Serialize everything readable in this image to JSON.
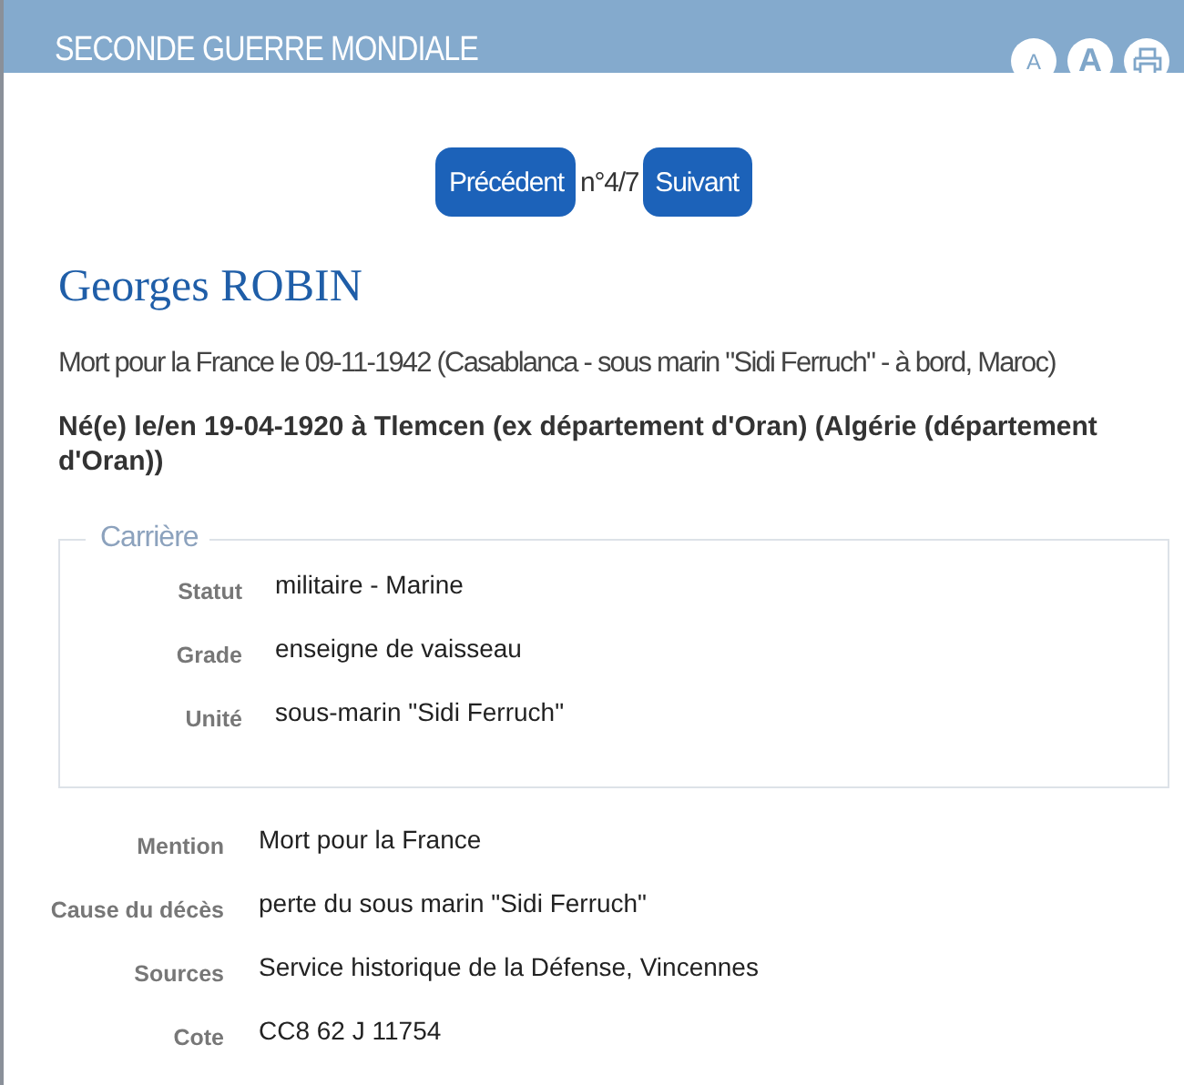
{
  "header": {
    "title": "SECONDE GUERRE MONDIALE",
    "tools": [
      {
        "kind": "font-small",
        "label": "A"
      },
      {
        "kind": "font-large",
        "label": "A"
      },
      {
        "kind": "print"
      }
    ]
  },
  "pager": {
    "previous": "Précédent",
    "position": "n°4/7",
    "next": "Suivant"
  },
  "person": {
    "name": "Georges ROBIN",
    "death": "Mort pour la France le 09-11-1942 (Casablanca - sous marin \"Sidi Ferruch\" - à bord, Maroc)",
    "birth": "Né(e) le/en 19-04-1920 à Tlemcen (ex département d'Oran) (Algérie (département d'Oran))"
  },
  "career": {
    "legend": "Carrière",
    "fields": [
      {
        "label": "Statut",
        "value": "militaire - Marine"
      },
      {
        "label": "Grade",
        "value": "enseigne de vaisseau"
      },
      {
        "label": "Unité",
        "value": "sous-marin \"Sidi Ferruch\""
      }
    ]
  },
  "details": [
    {
      "label": "Mention",
      "value": "Mort pour la France"
    },
    {
      "label": "Cause du décès",
      "value": "perte du sous marin \"Sidi Ferruch\""
    },
    {
      "label": "Sources",
      "value": "Service historique de la Défense, Vincennes"
    },
    {
      "label": "Cote",
      "value": "CC8 62 J 11754"
    }
  ]
}
